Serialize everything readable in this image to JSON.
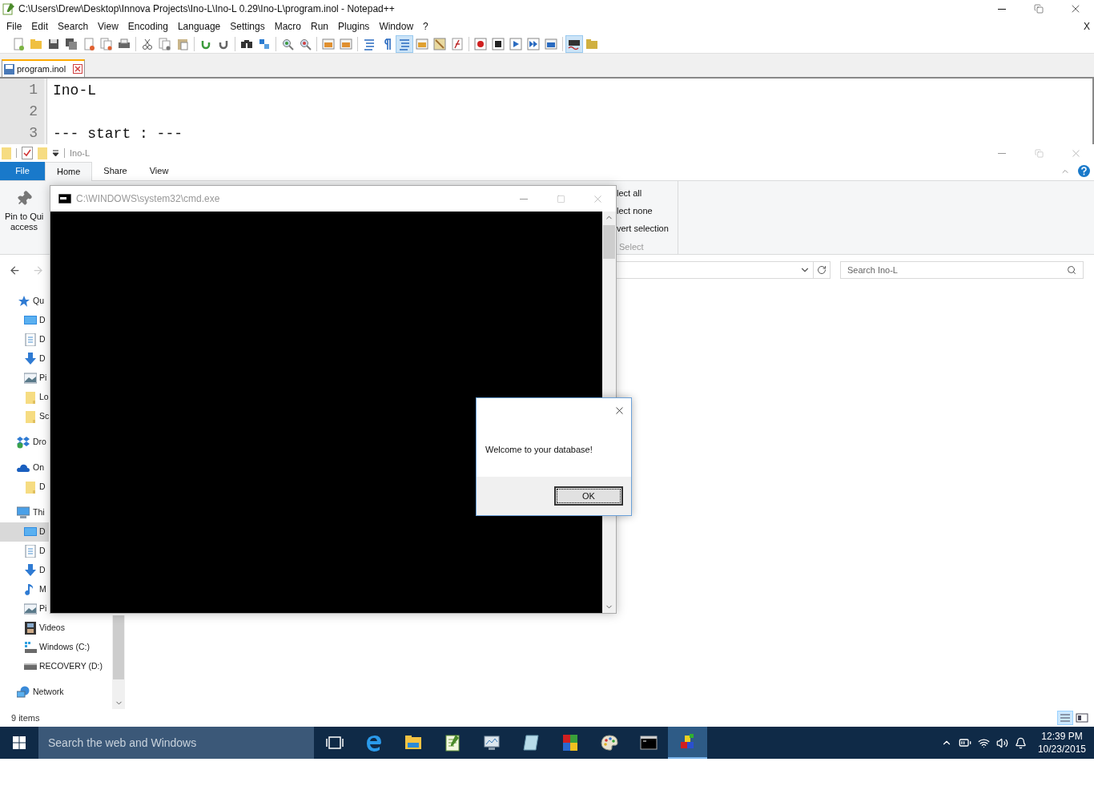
{
  "notepad": {
    "title": "C:\\Users\\Drew\\Desktop\\Innova Projects\\Ino-L\\Ino-L 0.29\\Ino-L\\program.inol - Notepad++",
    "menu": [
      "File",
      "Edit",
      "Search",
      "View",
      "Encoding",
      "Language",
      "Settings",
      "Macro",
      "Run",
      "Plugins",
      "Window",
      "?"
    ],
    "menu_close": "X",
    "toolbar": [
      {
        "selected": false
      },
      {
        "selected": false
      },
      {
        "selected": false
      },
      {
        "selected": false
      },
      {
        "selected": false
      },
      {
        "selected": false
      },
      {
        "selected": false
      },
      {
        "selected": false
      },
      {
        "selected": false
      },
      {
        "selected": false
      },
      {
        "selected": false
      },
      {
        "selected": false
      },
      {
        "selected": false
      },
      {
        "selected": false
      },
      {
        "selected": false
      },
      {
        "selected": false
      },
      {
        "selected": false
      },
      {
        "selected": false
      },
      {
        "selected": false
      },
      {
        "selected": false
      },
      {
        "selected": true
      },
      {
        "selected": false
      },
      {
        "selected": false
      },
      {
        "selected": false
      },
      {
        "selected": false
      },
      {
        "selected": false
      },
      {
        "selected": false
      },
      {
        "selected": false
      },
      {
        "selected": false
      },
      {
        "selected": true
      },
      {
        "selected": false
      }
    ],
    "tabs": [
      {
        "label": "program.inol",
        "selected": true
      }
    ],
    "lines": [
      {
        "number": "1",
        "text": "Ino-L"
      },
      {
        "number": "2"
      },
      {
        "number": "3",
        "text": "--- start : ---"
      }
    ]
  },
  "explorer": {
    "title": "Ino-L",
    "tabs": [
      {
        "label": "File",
        "kind": "file",
        "selected": false
      },
      {
        "label": "Home",
        "kind": "tab",
        "selected": true
      },
      {
        "label": "Share",
        "kind": "tab",
        "selected": false
      },
      {
        "label": "View",
        "kind": "tab",
        "selected": false
      }
    ],
    "pin_label": [
      "Pin to Qui",
      "access"
    ],
    "select_items": [
      "lect all",
      "lect none",
      "vert selection"
    ],
    "select_group": "Select",
    "search": {
      "placeholder": "Search Ino-L"
    },
    "nav": [
      {
        "label": "Qu",
        "kind": "star",
        "selected": false,
        "children": [
          {
            "label": "D",
            "kind": "desktop",
            "selected": false
          },
          {
            "label": "D",
            "kind": "document",
            "selected": false
          },
          {
            "label": "D",
            "kind": "download",
            "selected": false
          },
          {
            "label": "Pi",
            "kind": "pictures",
            "selected": false
          },
          {
            "label": "Lo",
            "kind": "folder",
            "selected": false
          },
          {
            "label": "Sc",
            "kind": "folder",
            "selected": false
          }
        ]
      },
      {
        "label": "Dro",
        "kind": "dropbox",
        "selected": false
      },
      {
        "label": "On",
        "kind": "onedrive",
        "selected": false,
        "children": [
          {
            "label": "D",
            "kind": "folder",
            "selected": false
          }
        ]
      },
      {
        "label": "Thi",
        "kind": "pc",
        "selected": false,
        "children": [
          {
            "label": "D",
            "kind": "desktop",
            "selected": true
          },
          {
            "label": "D",
            "kind": "document",
            "selected": false
          },
          {
            "label": "D",
            "kind": "download",
            "selected": false
          },
          {
            "label": "M",
            "kind": "music",
            "selected": false
          },
          {
            "label": "Pi",
            "kind": "pictures",
            "selected": false
          },
          {
            "label": "Videos",
            "kind": "videos",
            "selected": false
          },
          {
            "label": "Windows (C:)",
            "kind": "windows-drive",
            "selected": false
          },
          {
            "label": "RECOVERY (D:)",
            "kind": "drive",
            "selected": false
          }
        ]
      },
      {
        "label": "Network",
        "kind": "network",
        "selected": false
      }
    ],
    "status": "9 items"
  },
  "cmd": {
    "title": "C:\\WINDOWS\\system32\\cmd.exe"
  },
  "dialog": {
    "message": "Welcome to your database!",
    "button": "OK"
  },
  "taskbar": {
    "search_placeholder": "Search the web and Windows",
    "apps": [
      {
        "kind": "task-view",
        "selected": false
      },
      {
        "kind": "browser",
        "selected": false
      },
      {
        "kind": "folder",
        "selected": false
      },
      {
        "kind": "notepad",
        "selected": false
      },
      {
        "kind": "monitor",
        "selected": false
      },
      {
        "kind": "notebook",
        "selected": false
      },
      {
        "kind": "tiles",
        "selected": false
      },
      {
        "kind": "palette",
        "selected": false
      },
      {
        "kind": "terminal",
        "selected": false
      },
      {
        "kind": "blocks",
        "selected": true
      }
    ],
    "time": "12:39 PM",
    "date": "10/23/2015"
  }
}
